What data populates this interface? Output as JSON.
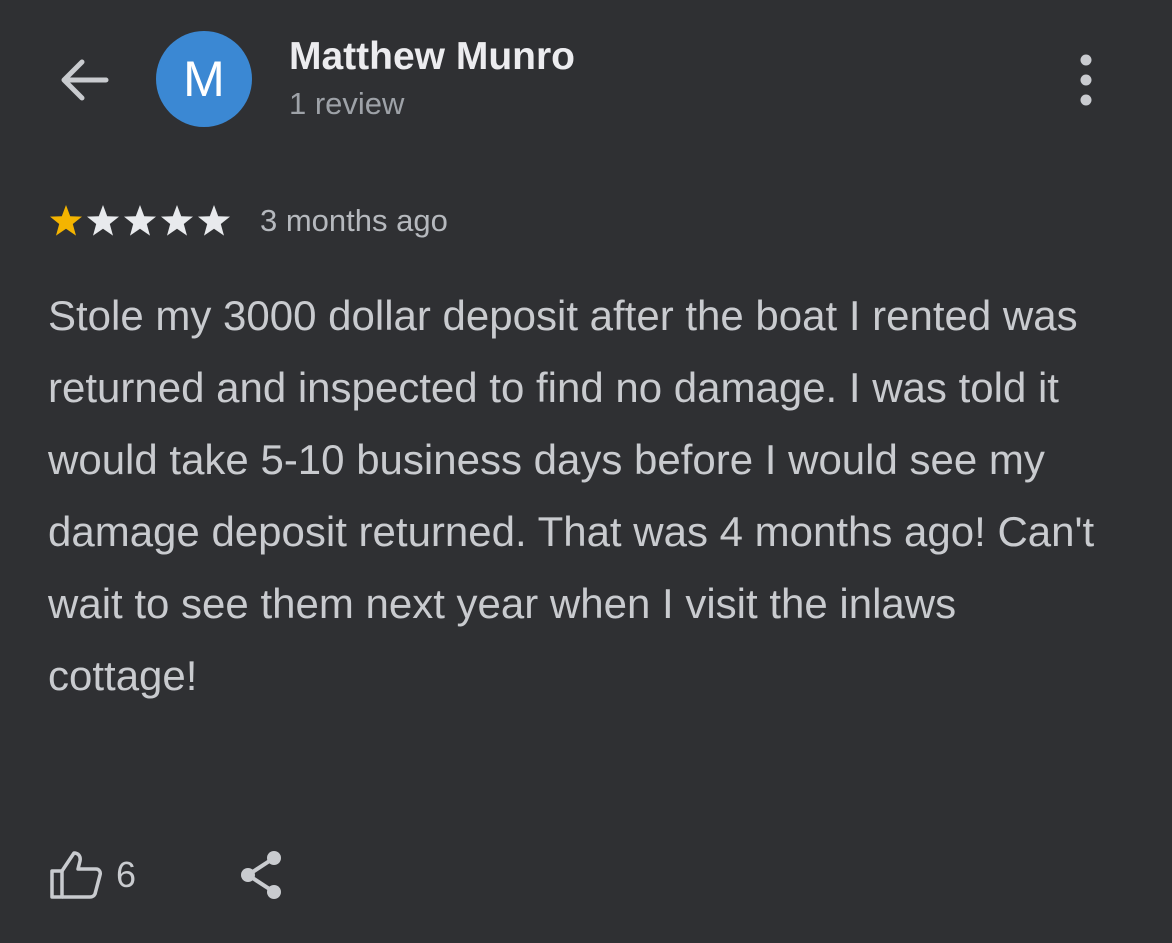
{
  "header": {
    "reviewer_name": "Matthew Munro",
    "reviewer_initial": "M",
    "reviewer_subtitle": "1 review",
    "avatar_color": "#3b88d3"
  },
  "review": {
    "rating": 1,
    "max_rating": 5,
    "star_filled_color": "#f4b400",
    "star_empty_color": "#e8eaed",
    "time_ago": "3 months ago",
    "text": "Stole my 3000 dollar deposit after the boat I rented was returned and inspected to find no damage. I was told it would take 5-10 business days before I would see my damage deposit returned. That was 4 months ago! Can't wait to see them next year when I visit the inlaws cottage!"
  },
  "actions": {
    "like_count": "6",
    "like_icon": "thumbs-up-icon",
    "share_icon": "share-icon"
  },
  "icons": {
    "back": "back-arrow-icon",
    "more": "more-vertical-icon"
  }
}
